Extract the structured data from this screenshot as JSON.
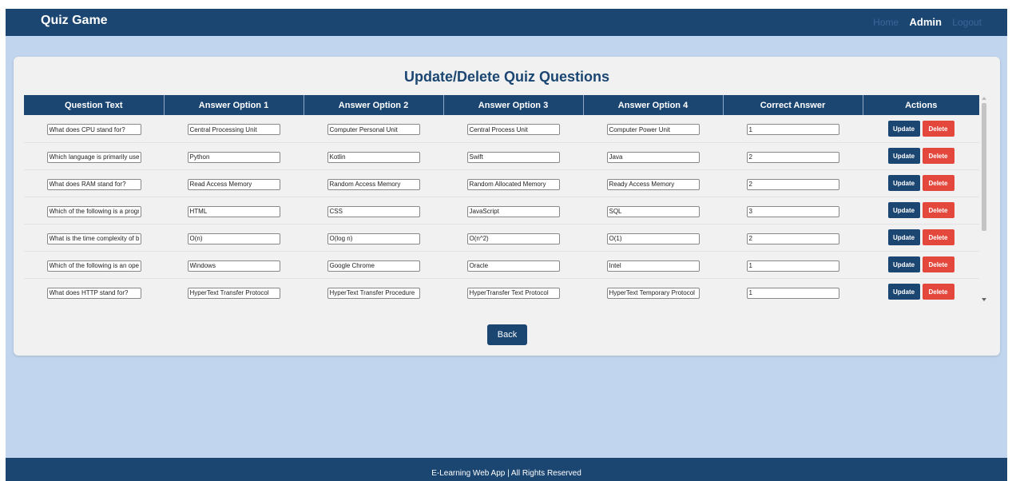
{
  "navbar": {
    "brand": "Quiz Game",
    "links": {
      "home": "Home",
      "admin": "Admin",
      "logout": "Logout"
    }
  },
  "page": {
    "title": "Update/Delete Quiz Questions",
    "back_label": "Back"
  },
  "table": {
    "headers": [
      "Question Text",
      "Answer Option 1",
      "Answer Option 2",
      "Answer Option 3",
      "Answer Option 4",
      "Correct Answer",
      "Actions"
    ],
    "update_label": "Update",
    "delete_label": "Delete",
    "rows": [
      {
        "question": "What does CPU stand for?",
        "a1": "Central Processing Unit",
        "a2": "Computer Personal Unit",
        "a3": "Central Process Unit",
        "a4": "Computer Power Unit",
        "correct": "1"
      },
      {
        "question": "Which language is primarily used for Android development?",
        "a1": "Python",
        "a2": "Kotlin",
        "a3": "Swift",
        "a4": "Java",
        "correct": "2"
      },
      {
        "question": "What does RAM stand for?",
        "a1": "Read Access Memory",
        "a2": "Random Access Memory",
        "a3": "Random Allocated Memory",
        "a4": "Ready Access Memory",
        "correct": "2"
      },
      {
        "question": "Which of the following is a programming language?",
        "a1": "HTML",
        "a2": "CSS",
        "a3": "JavaScript",
        "a4": "SQL",
        "correct": "3"
      },
      {
        "question": "What is the time complexity of binary search?",
        "a1": "O(n)",
        "a2": "O(log n)",
        "a3": "O(n^2)",
        "a4": "O(1)",
        "correct": "2"
      },
      {
        "question": "Which of the following is an operating system?",
        "a1": "Windows",
        "a2": "Google Chrome",
        "a3": "Oracle",
        "a4": "Intel",
        "correct": "1"
      },
      {
        "question": "What does HTTP stand for?",
        "a1": "HyperText Transfer Protocol",
        "a2": "HyperText Transfer Procedure",
        "a3": "HyperTransfer Text Protocol",
        "a4": "HyperText Temporary Protocol",
        "correct": "1"
      }
    ]
  },
  "footer": {
    "text": "E-Learning Web App | All Rights Reserved"
  }
}
